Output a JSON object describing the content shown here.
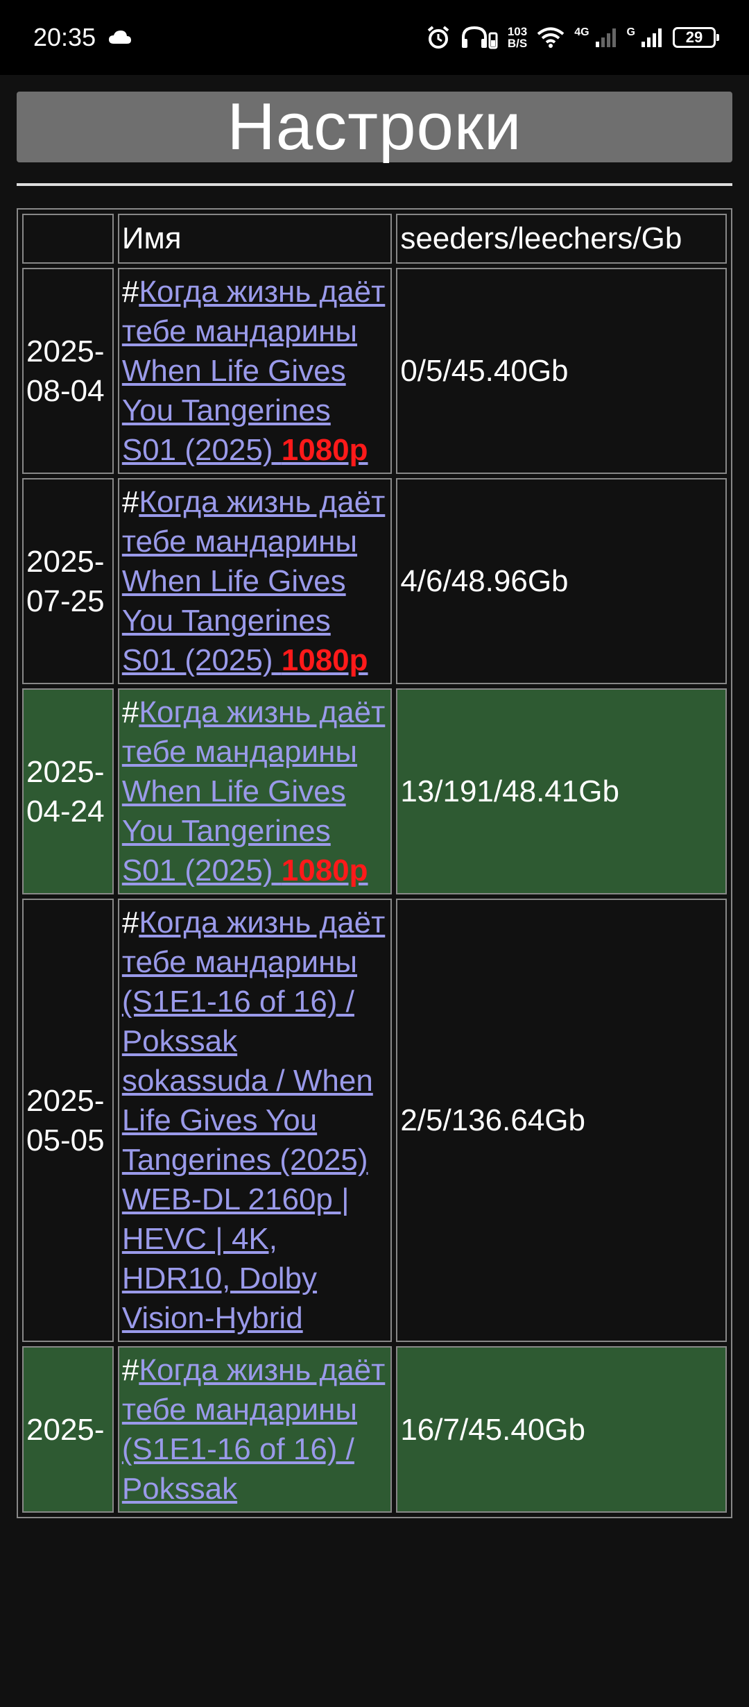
{
  "status_bar": {
    "time": "20:35",
    "net_speed_value": "103",
    "net_speed_unit": "B/S",
    "net_4g": "4G",
    "net_g": "G",
    "battery": "29"
  },
  "page": {
    "title": "Настроки"
  },
  "table": {
    "headers": [
      "",
      "Имя",
      "seeders/leechers/Gb"
    ],
    "rows": [
      {
        "date": "2025-08-04",
        "prefix": "#",
        "title": "Когда жизнь даёт тебе мандарины When Life Gives You Tangerines S01 (2025)",
        "quality": "1080p",
        "stats": "0/5/45.40Gb",
        "highlight": false
      },
      {
        "date": "2025-07-25",
        "prefix": "#",
        "title": "Когда жизнь даёт тебе мандарины When Life Gives You Tangerines S01 (2025)",
        "quality": "1080p",
        "stats": "4/6/48.96Gb",
        "highlight": false
      },
      {
        "date": "2025-04-24",
        "prefix": "#",
        "title": "Когда жизнь даёт тебе мандарины When Life Gives You Tangerines S01 (2025)",
        "quality": "1080p",
        "stats": "13/191/48.41Gb",
        "highlight": true
      },
      {
        "date": "2025-05-05",
        "prefix": "#",
        "title": "Когда жизнь даёт тебе мандарины (S1E1-16 of 16) / Pokssak sokassuda / When Life Gives You Tangerines (2025) WEB-DL 2160p | HEVC | 4K, HDR10, Dolby Vision-Hybrid",
        "quality": "",
        "stats": "2/5/136.64Gb",
        "highlight": false
      },
      {
        "date": "2025-",
        "prefix": "#",
        "title": "Когда жизнь даёт тебе мандарины (S1E1-16 of 16) / Pokssak",
        "quality": "",
        "stats": "16/7/45.40Gb",
        "highlight": true
      }
    ]
  }
}
